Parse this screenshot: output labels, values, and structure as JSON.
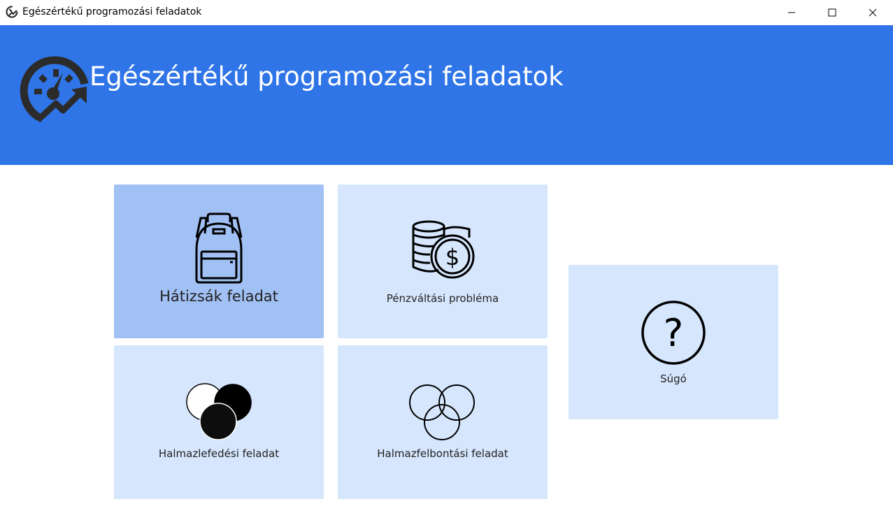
{
  "window": {
    "title": "Egészértékű programozási feladatok",
    "controls": {
      "minimize": "minimize",
      "maximize": "maximize",
      "close": "close"
    }
  },
  "header": {
    "title": "Egészértékű programozási feladatok",
    "background_color": "#2f75e8"
  },
  "tiles": [
    {
      "label": "Hátizsák feladat",
      "icon": "backpack-icon",
      "state": "selected",
      "color": "#a1c0f4"
    },
    {
      "label": "Pénzváltási probléma",
      "icon": "coins-dollar-icon",
      "state": "normal",
      "color": "#d6e6fd"
    },
    {
      "label": "Halmazlefedési feladat",
      "icon": "set-cover-circles-icon",
      "state": "normal",
      "color": "#d6e6fd"
    },
    {
      "label": "Halmazfelbontási feladat",
      "icon": "set-partition-circles-icon",
      "state": "normal",
      "color": "#d6e6fd"
    },
    {
      "label": "Súgó",
      "icon": "question-mark-icon",
      "state": "normal",
      "color": "#d6e6fd"
    }
  ]
}
